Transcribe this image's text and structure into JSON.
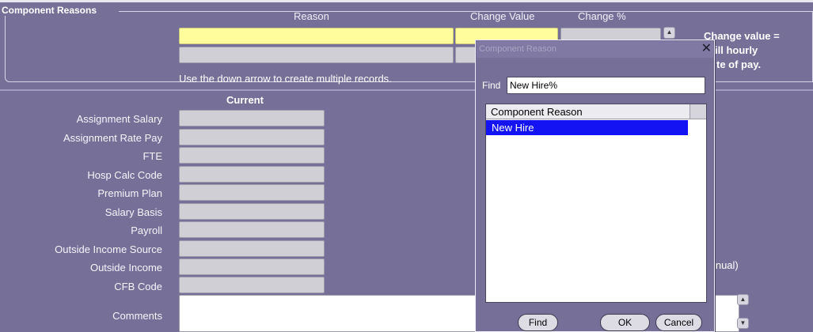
{
  "group": {
    "title": "Component Reasons",
    "columns": {
      "reason": "Reason",
      "change_value": "Change Value",
      "change_pct": "Change %"
    },
    "hint": "Use the down arrow to create multiple records.",
    "note_line1": "Change value =",
    "note_line2": "ill hourly",
    "note_line3": "te of pay."
  },
  "current_section": {
    "header": "Current",
    "rows": [
      "Assignment Salary",
      "Assignment Rate Pay",
      "FTE",
      "Hosp Calc Code",
      "Premium Plan",
      "Salary Basis",
      "Payroll",
      "Outside Income Source",
      "Outside Income",
      "CFB Code",
      "Comments"
    ],
    "annual_suffix": ".nnual)"
  },
  "dialog": {
    "title": "Component Reason",
    "close_icon": "close-icon",
    "find_label": "Find",
    "find_value": "New Hire%",
    "list_header": "Component Reason",
    "items": [
      "New Hire"
    ],
    "buttons": {
      "find": "Find",
      "ok": "OK",
      "cancel": "Cancel"
    }
  },
  "colors": {
    "background": "#767098",
    "required_field": "#fffd9c",
    "selection": "#1313f3"
  }
}
